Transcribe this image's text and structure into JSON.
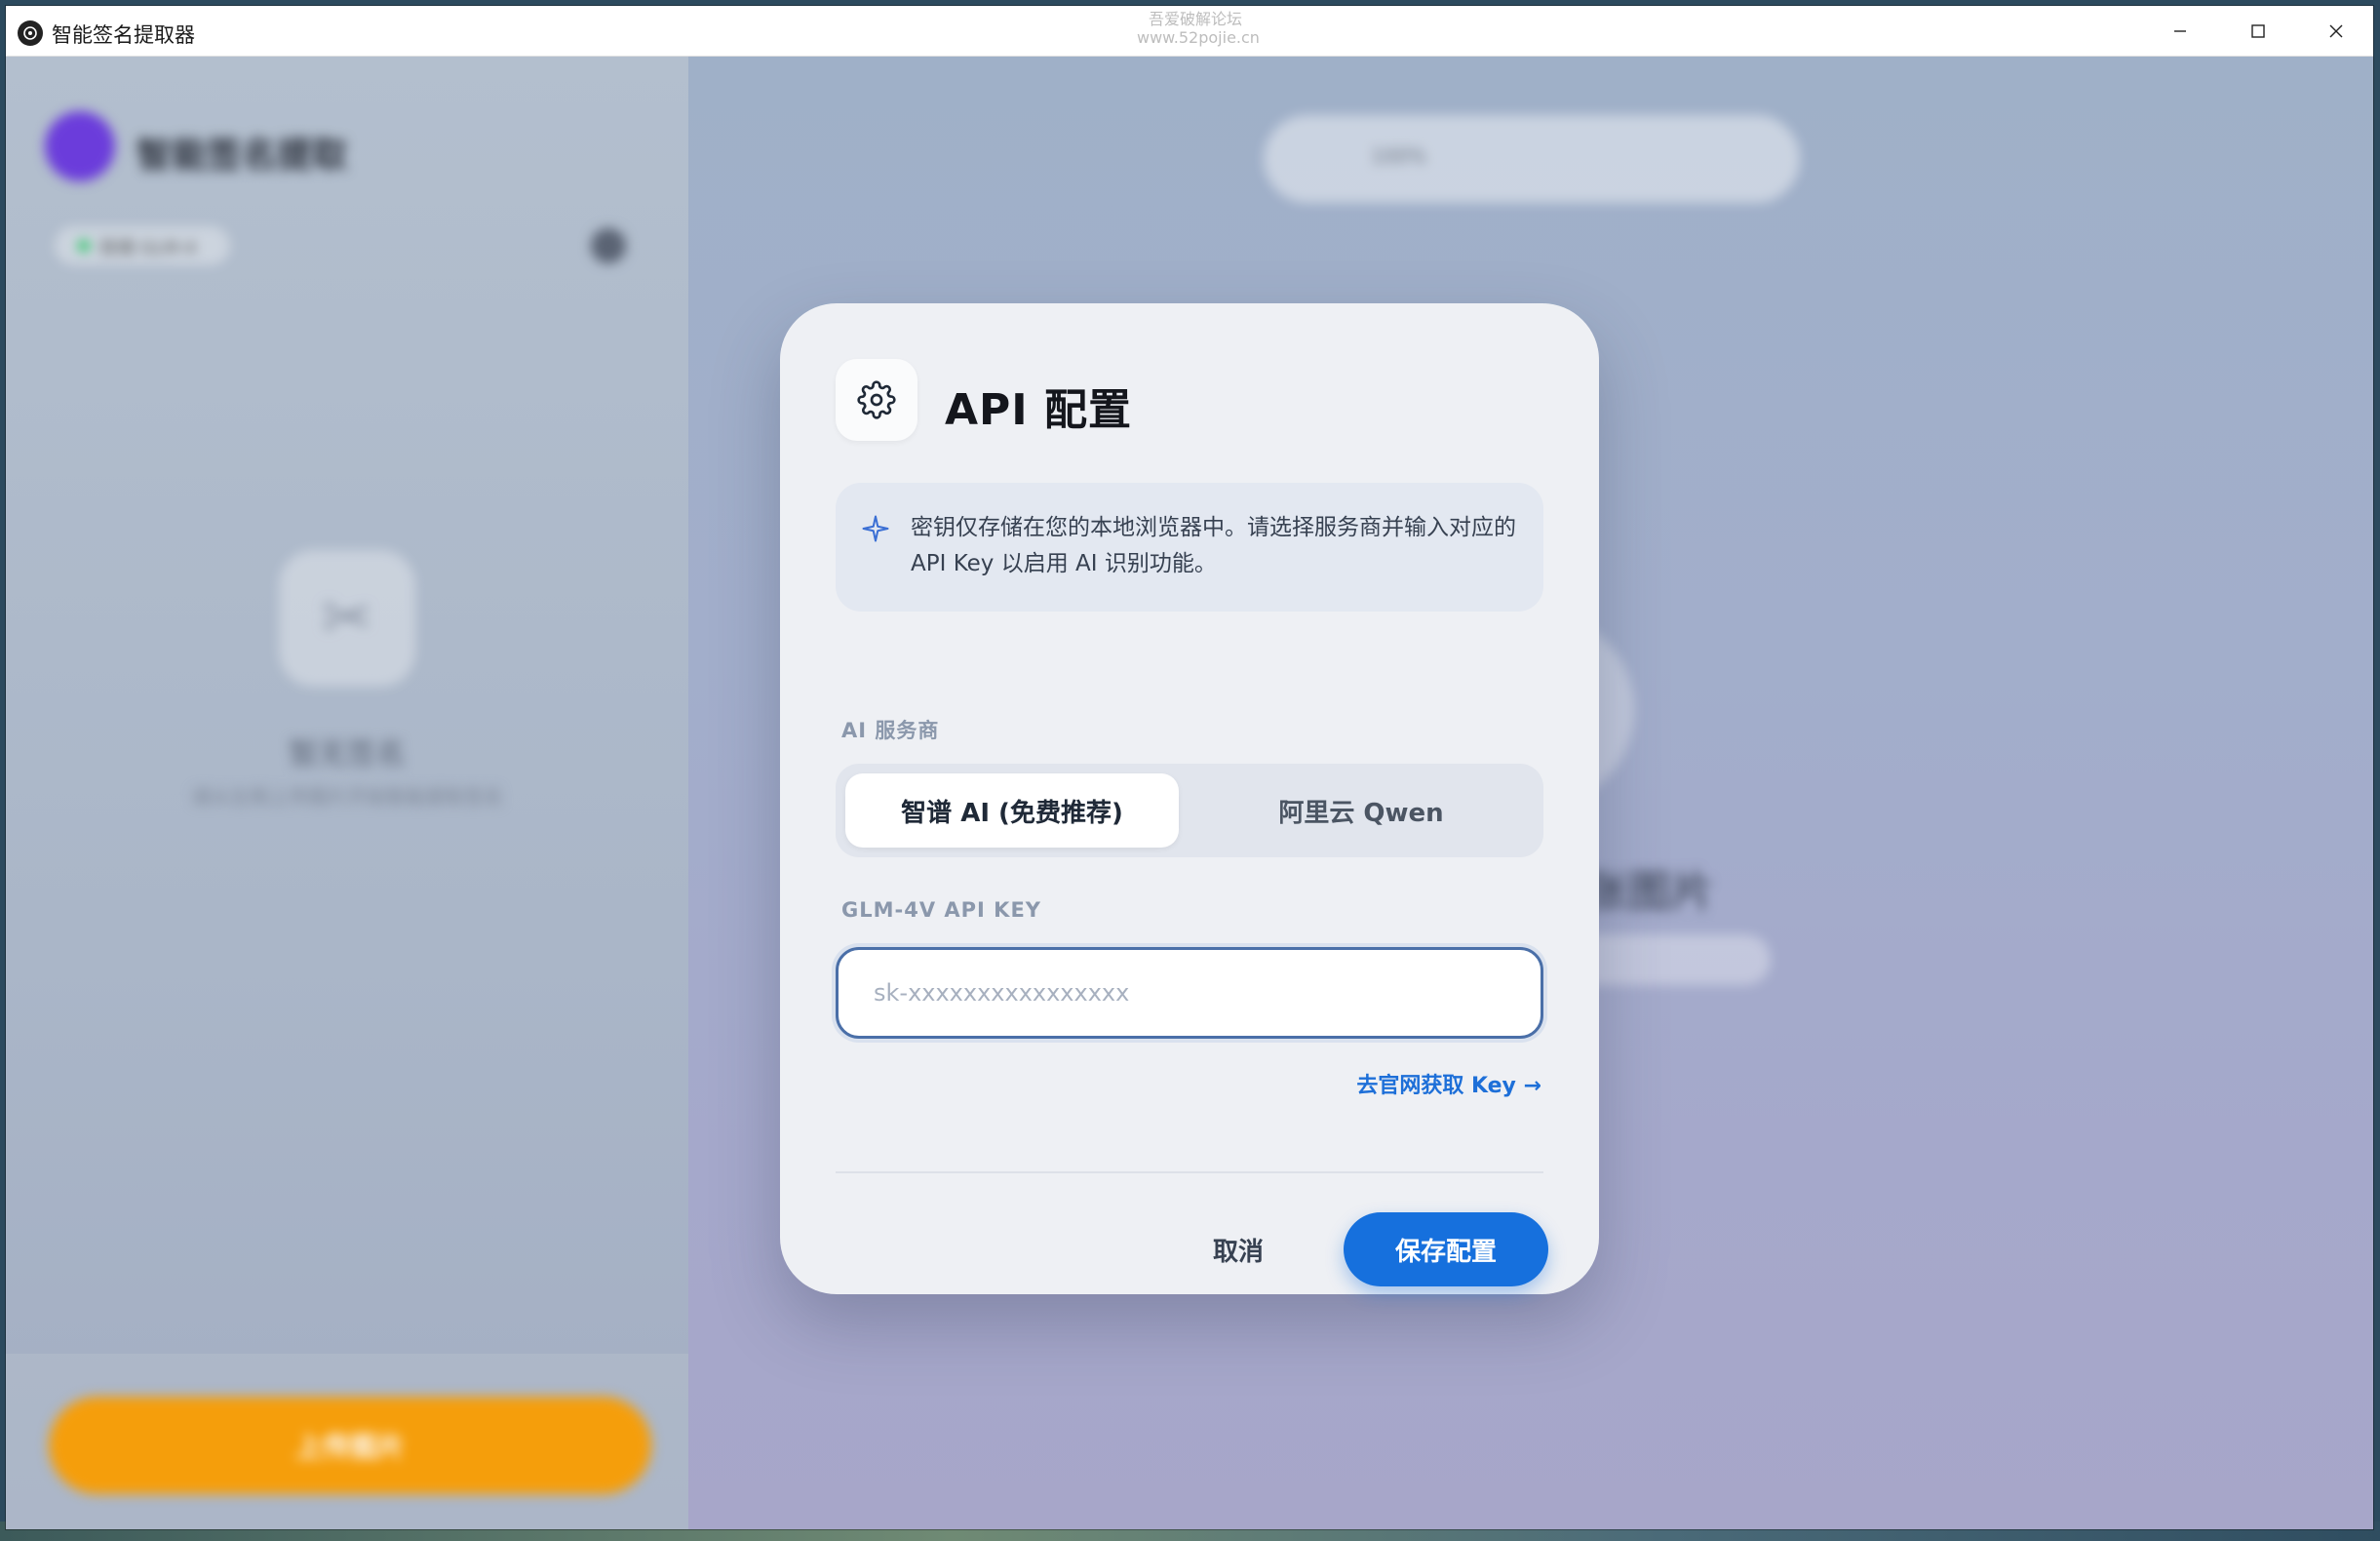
{
  "window": {
    "title": "智能签名提取器",
    "watermark_line1": "吾爱破解论坛",
    "watermark_line2": "www.52pojie.cn"
  },
  "background": {
    "sidebar_title": "智能签名提取",
    "status_text": "就绪 GLM-4",
    "empty_title": "暂无签名",
    "empty_subtitle": "请从左侧上传图片开始智能提取签名",
    "upload_label": "上传图片",
    "main_title": "请先上传一张图片",
    "toolbar_zoom": "100%"
  },
  "modal": {
    "title": "API 配置",
    "info_text": "密钥仅存储在您的本地浏览器中。请选择服务商并输入对应的 API Key 以启用 AI 识别功能。",
    "provider_label": "AI 服务商",
    "providers": [
      {
        "label": "智谱 AI (免费推荐)",
        "active": true
      },
      {
        "label": "阿里云 Qwen",
        "active": false
      }
    ],
    "key_label": "GLM-4V API KEY",
    "key_value": "",
    "key_placeholder": "sk-xxxxxxxxxxxxxxxx",
    "get_key_link": "去官网获取 Key →",
    "cancel_label": "取消",
    "save_label": "保存配置"
  },
  "colors": {
    "accent": "#1670dd",
    "upload": "#f59e0b",
    "status_ok": "#22c55e"
  },
  "icons": {
    "modal": "gear-icon",
    "info": "sparkle-icon",
    "window_controls": [
      "minimize-icon",
      "maximize-icon",
      "close-icon"
    ]
  }
}
